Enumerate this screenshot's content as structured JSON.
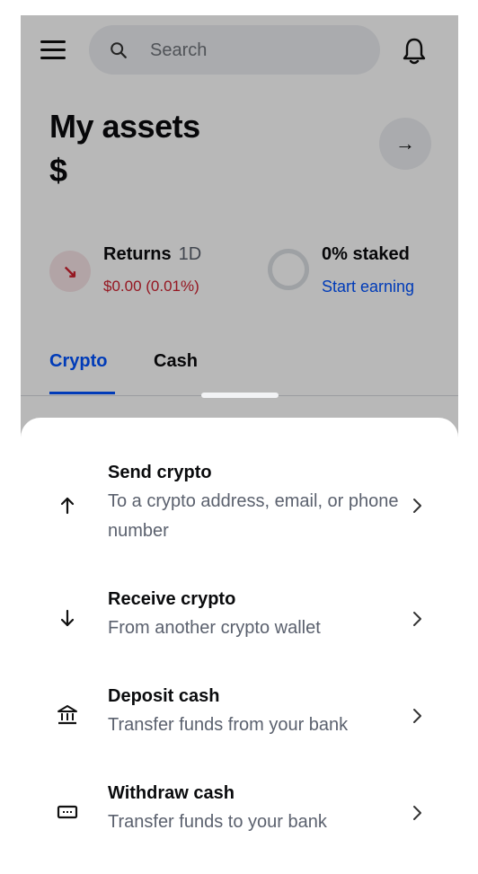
{
  "search": {
    "placeholder": "Search"
  },
  "assets": {
    "title": "My assets",
    "balance": "$"
  },
  "returns": {
    "label": "Returns",
    "period": "1D",
    "value": "$0.00 (0.01%)"
  },
  "staking": {
    "label": "0% staked",
    "link": "Start earning"
  },
  "tabs": [
    {
      "label": "Crypto",
      "active": true
    },
    {
      "label": "Cash",
      "active": false
    }
  ],
  "colors": {
    "accent": "#0052ff",
    "negative": "#cf202f"
  },
  "sheet": {
    "items": [
      {
        "title": "Send crypto",
        "subtitle": "To a crypto address, email, or phone number",
        "icon": "arrow-up-icon"
      },
      {
        "title": "Receive crypto",
        "subtitle": "From another crypto wallet",
        "icon": "arrow-down-icon"
      },
      {
        "title": "Deposit cash",
        "subtitle": "Transfer funds from your bank",
        "icon": "bank-icon"
      },
      {
        "title": "Withdraw cash",
        "subtitle": "Transfer funds to your bank",
        "icon": "cash-icon"
      }
    ]
  }
}
